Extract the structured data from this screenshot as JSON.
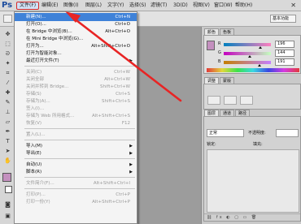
{
  "app": {
    "logo": "Ps",
    "close": "✕"
  },
  "menubar": [
    {
      "name": "menu-file",
      "label": "文件(F)"
    },
    {
      "name": "menu-edit",
      "label": "编辑(E)"
    },
    {
      "name": "menu-image",
      "label": "图像(I)"
    },
    {
      "name": "menu-layer",
      "label": "图层(L)"
    },
    {
      "name": "menu-type",
      "label": "文字(Y)"
    },
    {
      "name": "menu-select",
      "label": "选择(S)"
    },
    {
      "name": "menu-filter",
      "label": "滤镜(T)"
    },
    {
      "name": "menu-3d",
      "label": "3D(D)"
    },
    {
      "name": "menu-view",
      "label": "视图(V)"
    },
    {
      "name": "menu-window",
      "label": "窗口(W)"
    },
    {
      "name": "menu-help",
      "label": "帮助(H)"
    }
  ],
  "options": {
    "essentials": "基本功能"
  },
  "file_menu": [
    {
      "label": "新建(N)...",
      "shortcut": "Ctrl+N",
      "state": "highlight"
    },
    {
      "label": "打开(O)...",
      "shortcut": "Ctrl+O"
    },
    {
      "label": "在 Bridge 中浏览(B)...",
      "shortcut": "Alt+Ctrl+O"
    },
    {
      "label": "在 Mini Bridge 中浏览(G)...",
      "shortcut": ""
    },
    {
      "label": "打开为...",
      "shortcut": "Alt+Shift+Ctrl+O"
    },
    {
      "label": "打开为智能对象...",
      "shortcut": ""
    },
    {
      "label": "最近打开文件(T)",
      "shortcut": "",
      "submenu": true
    },
    {
      "sep": true
    },
    {
      "label": "关闭(C)",
      "shortcut": "Ctrl+W",
      "state": "disabled"
    },
    {
      "label": "关闭全部",
      "shortcut": "Alt+Ctrl+W",
      "state": "disabled"
    },
    {
      "label": "关闭并转到 Bridge...",
      "shortcut": "Shift+Ctrl+W",
      "state": "disabled"
    },
    {
      "label": "存储(S)",
      "shortcut": "Ctrl+S",
      "state": "disabled"
    },
    {
      "label": "存储为(A)...",
      "shortcut": "Shift+Ctrl+S",
      "state": "disabled"
    },
    {
      "label": "签入(I)...",
      "shortcut": "",
      "state": "disabled"
    },
    {
      "label": "存储为 Web 所用格式...",
      "shortcut": "Alt+Shift+Ctrl+S",
      "state": "disabled"
    },
    {
      "label": "恢复(V)",
      "shortcut": "F12",
      "state": "disabled"
    },
    {
      "sep": true
    },
    {
      "label": "置入(L)...",
      "shortcut": "",
      "state": "disabled"
    },
    {
      "sep": true
    },
    {
      "label": "导入(M)",
      "shortcut": "",
      "submenu": true
    },
    {
      "label": "导出(E)",
      "shortcut": "",
      "submenu": true
    },
    {
      "sep": true
    },
    {
      "label": "自动(U)",
      "shortcut": "",
      "submenu": true
    },
    {
      "label": "脚本(R)",
      "shortcut": "",
      "submenu": true
    },
    {
      "sep": true
    },
    {
      "label": "文件简介(F)...",
      "shortcut": "Alt+Shift+Ctrl+I",
      "state": "disabled"
    },
    {
      "sep": true
    },
    {
      "label": "打印(P)...",
      "shortcut": "Ctrl+P",
      "state": "disabled"
    },
    {
      "label": "打印一份(Y)",
      "shortcut": "Alt+Shift+Ctrl+P",
      "state": "disabled"
    }
  ],
  "color_panel": {
    "tabs": [
      "颜色",
      "色板"
    ],
    "channels": [
      {
        "letter": "R",
        "value": "196",
        "track": "linear-gradient(to right, #007fbf, #ff7fbf)",
        "level": 0.77
      },
      {
        "letter": "G",
        "value": "144",
        "track": "linear-gradient(to right, #c400bf, #c4ffbf)",
        "level": 0.56
      },
      {
        "letter": "B",
        "value": "191",
        "track": "linear-gradient(to right, #c47f00, #c47fff)",
        "level": 0.75
      }
    ],
    "foreground": "#c490bf"
  },
  "adjust_panel": {
    "tabs": [
      "调整",
      "蒙版"
    ]
  },
  "layers_panel": {
    "tabs": [
      "图层",
      "通道",
      "路径"
    ],
    "blend_mode": "正常",
    "opacity_label": "不透明度:",
    "lock_label": "锁定:",
    "fill_label": "填充:",
    "bottom_icons": "⛓ fx ◐ ▢ ▭ 🗑"
  }
}
